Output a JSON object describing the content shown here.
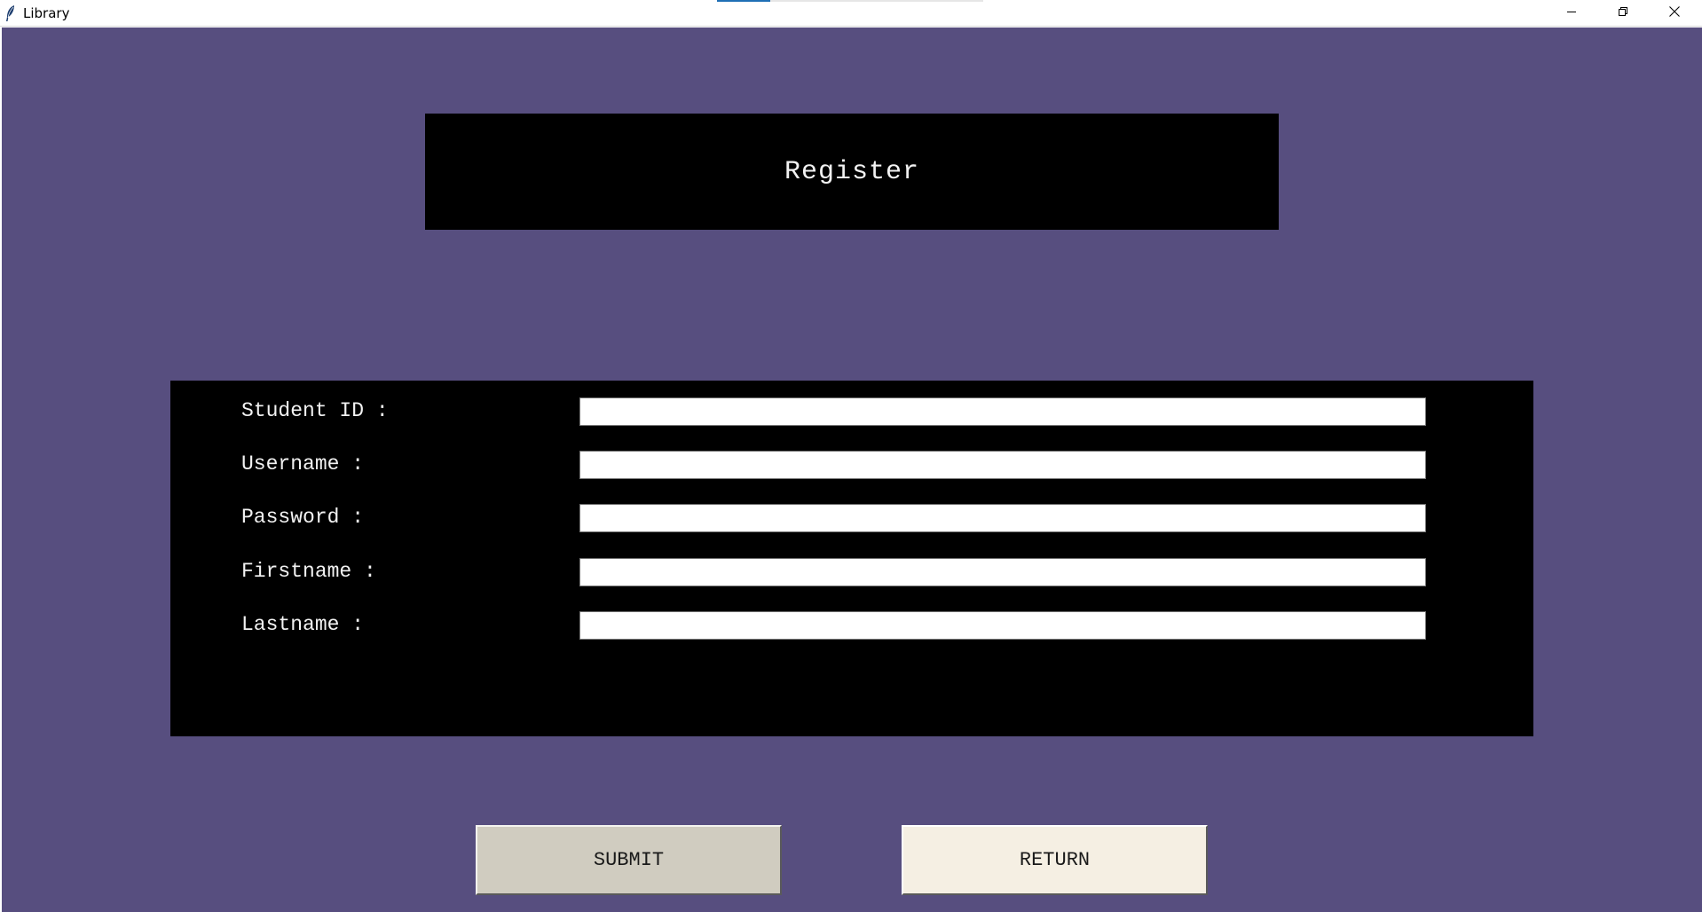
{
  "window": {
    "title": "Library"
  },
  "icons": {
    "app": "feather-icon",
    "minimize": "minimize-icon",
    "maximize": "restore-icon",
    "close": "close-icon"
  },
  "heading": {
    "text": "Register"
  },
  "form": {
    "fields": [
      {
        "label": "Student ID :",
        "value": "",
        "placeholder": ""
      },
      {
        "label": "Username :",
        "value": "",
        "placeholder": ""
      },
      {
        "label": "Password :",
        "value": "",
        "placeholder": ""
      },
      {
        "label": "Firstname :",
        "value": "",
        "placeholder": ""
      },
      {
        "label": "Lastname :",
        "value": "",
        "placeholder": ""
      }
    ]
  },
  "buttons": {
    "submit_label": "SUBMIT",
    "return_label": "RETURN"
  },
  "colors": {
    "background": "#574e7f",
    "panel": "#000000",
    "label_text": "#f2f2f2",
    "submit_bg": "#d0ccc0",
    "return_bg": "#f5efe3"
  }
}
